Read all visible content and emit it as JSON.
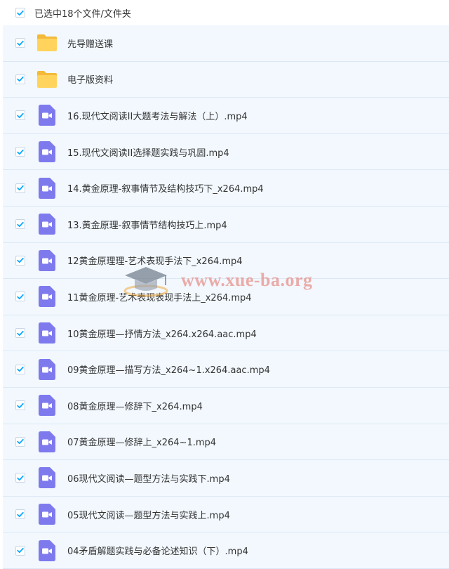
{
  "header": {
    "label": "已选中18个文件/文件夹",
    "checked": true
  },
  "colors": {
    "checkbox": "#06a7ff",
    "folder": "#ffd35c",
    "video": "#7e7aee",
    "row_bg": "#f2f8fe"
  },
  "items": [
    {
      "type": "folder",
      "name": "先导赠送课",
      "checked": true
    },
    {
      "type": "folder",
      "name": "电子版资料",
      "checked": true
    },
    {
      "type": "video",
      "name": "16.现代文阅读II大题考法与解法（上）.mp4",
      "checked": true
    },
    {
      "type": "video",
      "name": "15.现代文阅读II选择题实践与巩固.mp4",
      "checked": true
    },
    {
      "type": "video",
      "name": "14.黄金原理-叙事情节及结构技巧下_x264.mp4",
      "checked": true
    },
    {
      "type": "video",
      "name": "13.黄金原理-叙事情节结构技巧上.mp4",
      "checked": true
    },
    {
      "type": "video",
      "name": "12黄金原理理-艺术表现手法下_x264.mp4",
      "checked": true
    },
    {
      "type": "video",
      "name": "11黄金原理-艺术表现表现手法上_x264.mp4",
      "checked": true
    },
    {
      "type": "video",
      "name": "10黄金原理—抒情方法_x264.x264.aac.mp4",
      "checked": true
    },
    {
      "type": "video",
      "name": "09黄金原理—描写方法_x264~1.x264.aac.mp4",
      "checked": true
    },
    {
      "type": "video",
      "name": "08黄金原理—修辞下_x264.mp4",
      "checked": true
    },
    {
      "type": "video",
      "name": "07黄金原理—修辞上_x264~1.mp4",
      "checked": true
    },
    {
      "type": "video",
      "name": "06现代文阅读—题型方法与实践下.mp4",
      "checked": true
    },
    {
      "type": "video",
      "name": "05现代文阅读—题型方法与实践上.mp4",
      "checked": true
    },
    {
      "type": "video",
      "name": "04矛盾解题实践与必备论述知识（下）.mp4",
      "checked": true
    }
  ],
  "watermark": {
    "text": "www.xue-ba.org",
    "icon": "graduation-cap-icon"
  }
}
